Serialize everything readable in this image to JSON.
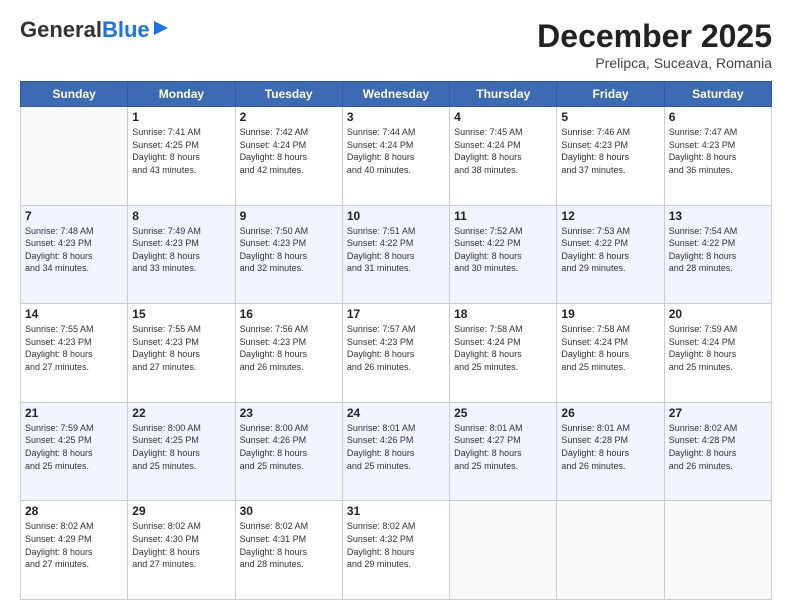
{
  "header": {
    "logo_line1": "General",
    "logo_line2": "Blue",
    "title": "December 2025",
    "subtitle": "Prelipca, Suceava, Romania"
  },
  "days_of_week": [
    "Sunday",
    "Monday",
    "Tuesday",
    "Wednesday",
    "Thursday",
    "Friday",
    "Saturday"
  ],
  "weeks": [
    [
      {
        "num": "",
        "info": ""
      },
      {
        "num": "1",
        "info": "Sunrise: 7:41 AM\nSunset: 4:25 PM\nDaylight: 8 hours\nand 43 minutes."
      },
      {
        "num": "2",
        "info": "Sunrise: 7:42 AM\nSunset: 4:24 PM\nDaylight: 8 hours\nand 42 minutes."
      },
      {
        "num": "3",
        "info": "Sunrise: 7:44 AM\nSunset: 4:24 PM\nDaylight: 8 hours\nand 40 minutes."
      },
      {
        "num": "4",
        "info": "Sunrise: 7:45 AM\nSunset: 4:24 PM\nDaylight: 8 hours\nand 38 minutes."
      },
      {
        "num": "5",
        "info": "Sunrise: 7:46 AM\nSunset: 4:23 PM\nDaylight: 8 hours\nand 37 minutes."
      },
      {
        "num": "6",
        "info": "Sunrise: 7:47 AM\nSunset: 4:23 PM\nDaylight: 8 hours\nand 36 minutes."
      }
    ],
    [
      {
        "num": "7",
        "info": "Sunrise: 7:48 AM\nSunset: 4:23 PM\nDaylight: 8 hours\nand 34 minutes."
      },
      {
        "num": "8",
        "info": "Sunrise: 7:49 AM\nSunset: 4:23 PM\nDaylight: 8 hours\nand 33 minutes."
      },
      {
        "num": "9",
        "info": "Sunrise: 7:50 AM\nSunset: 4:23 PM\nDaylight: 8 hours\nand 32 minutes."
      },
      {
        "num": "10",
        "info": "Sunrise: 7:51 AM\nSunset: 4:22 PM\nDaylight: 8 hours\nand 31 minutes."
      },
      {
        "num": "11",
        "info": "Sunrise: 7:52 AM\nSunset: 4:22 PM\nDaylight: 8 hours\nand 30 minutes."
      },
      {
        "num": "12",
        "info": "Sunrise: 7:53 AM\nSunset: 4:22 PM\nDaylight: 8 hours\nand 29 minutes."
      },
      {
        "num": "13",
        "info": "Sunrise: 7:54 AM\nSunset: 4:22 PM\nDaylight: 8 hours\nand 28 minutes."
      }
    ],
    [
      {
        "num": "14",
        "info": "Sunrise: 7:55 AM\nSunset: 4:23 PM\nDaylight: 8 hours\nand 27 minutes."
      },
      {
        "num": "15",
        "info": "Sunrise: 7:55 AM\nSunset: 4:23 PM\nDaylight: 8 hours\nand 27 minutes."
      },
      {
        "num": "16",
        "info": "Sunrise: 7:56 AM\nSunset: 4:23 PM\nDaylight: 8 hours\nand 26 minutes."
      },
      {
        "num": "17",
        "info": "Sunrise: 7:57 AM\nSunset: 4:23 PM\nDaylight: 8 hours\nand 26 minutes."
      },
      {
        "num": "18",
        "info": "Sunrise: 7:58 AM\nSunset: 4:24 PM\nDaylight: 8 hours\nand 25 minutes."
      },
      {
        "num": "19",
        "info": "Sunrise: 7:58 AM\nSunset: 4:24 PM\nDaylight: 8 hours\nand 25 minutes."
      },
      {
        "num": "20",
        "info": "Sunrise: 7:59 AM\nSunset: 4:24 PM\nDaylight: 8 hours\nand 25 minutes."
      }
    ],
    [
      {
        "num": "21",
        "info": "Sunrise: 7:59 AM\nSunset: 4:25 PM\nDaylight: 8 hours\nand 25 minutes."
      },
      {
        "num": "22",
        "info": "Sunrise: 8:00 AM\nSunset: 4:25 PM\nDaylight: 8 hours\nand 25 minutes."
      },
      {
        "num": "23",
        "info": "Sunrise: 8:00 AM\nSunset: 4:26 PM\nDaylight: 8 hours\nand 25 minutes."
      },
      {
        "num": "24",
        "info": "Sunrise: 8:01 AM\nSunset: 4:26 PM\nDaylight: 8 hours\nand 25 minutes."
      },
      {
        "num": "25",
        "info": "Sunrise: 8:01 AM\nSunset: 4:27 PM\nDaylight: 8 hours\nand 25 minutes."
      },
      {
        "num": "26",
        "info": "Sunrise: 8:01 AM\nSunset: 4:28 PM\nDaylight: 8 hours\nand 26 minutes."
      },
      {
        "num": "27",
        "info": "Sunrise: 8:02 AM\nSunset: 4:28 PM\nDaylight: 8 hours\nand 26 minutes."
      }
    ],
    [
      {
        "num": "28",
        "info": "Sunrise: 8:02 AM\nSunset: 4:29 PM\nDaylight: 8 hours\nand 27 minutes."
      },
      {
        "num": "29",
        "info": "Sunrise: 8:02 AM\nSunset: 4:30 PM\nDaylight: 8 hours\nand 27 minutes."
      },
      {
        "num": "30",
        "info": "Sunrise: 8:02 AM\nSunset: 4:31 PM\nDaylight: 8 hours\nand 28 minutes."
      },
      {
        "num": "31",
        "info": "Sunrise: 8:02 AM\nSunset: 4:32 PM\nDaylight: 8 hours\nand 29 minutes."
      },
      {
        "num": "",
        "info": ""
      },
      {
        "num": "",
        "info": ""
      },
      {
        "num": "",
        "info": ""
      }
    ]
  ]
}
